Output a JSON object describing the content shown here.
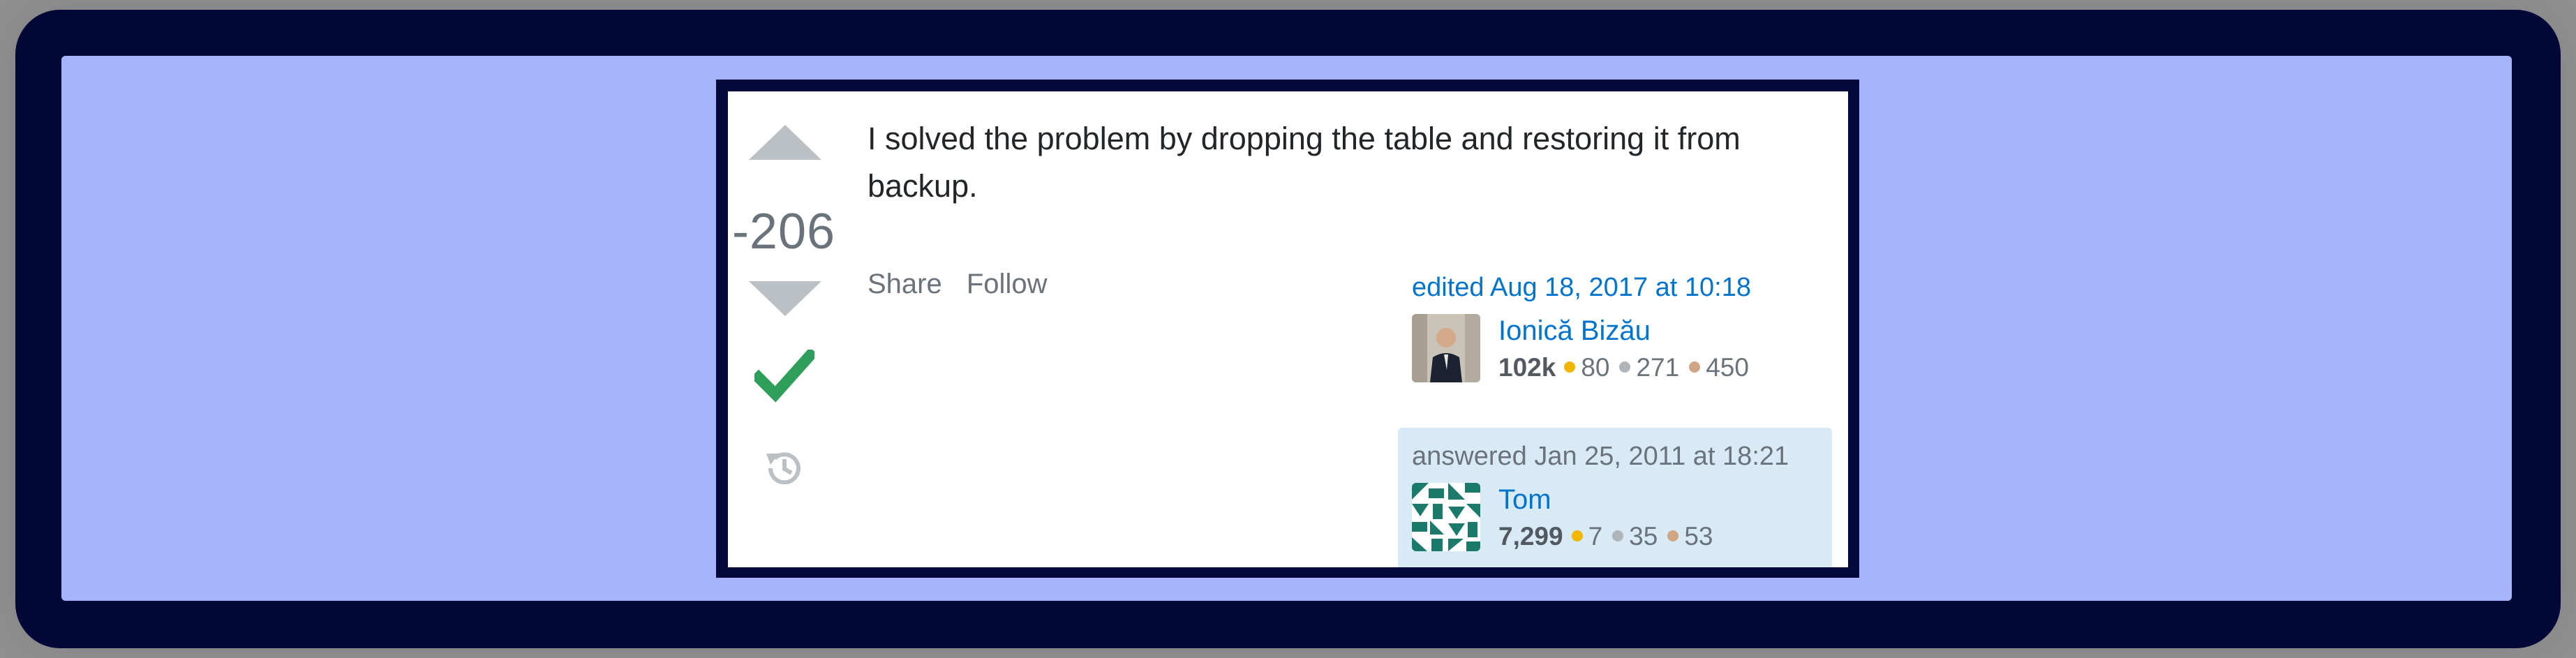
{
  "vote": {
    "count": "-206"
  },
  "post": {
    "body": "I solved the problem by dropping the table and restoring it from backup."
  },
  "actions": {
    "share": "Share",
    "follow": "Follow"
  },
  "edited": {
    "label": "edited Aug 18, 2017 at 10:18",
    "user": {
      "name": "Ionică Bizău",
      "reputation": "102k",
      "gold": "80",
      "silver": "271",
      "bronze": "450"
    }
  },
  "answered": {
    "label": "answered Jan 25, 2011 at 18:21",
    "user": {
      "name": "Tom",
      "reputation": "7,299",
      "gold": "7",
      "silver": "35",
      "bronze": "53"
    }
  },
  "colors": {
    "link": "#0074cc",
    "accepted": "#2f9e5a",
    "gold": "#f1b600",
    "silver": "#b0b5ba",
    "bronze": "#d1a684",
    "owner_bg": "#d9eaf7"
  }
}
